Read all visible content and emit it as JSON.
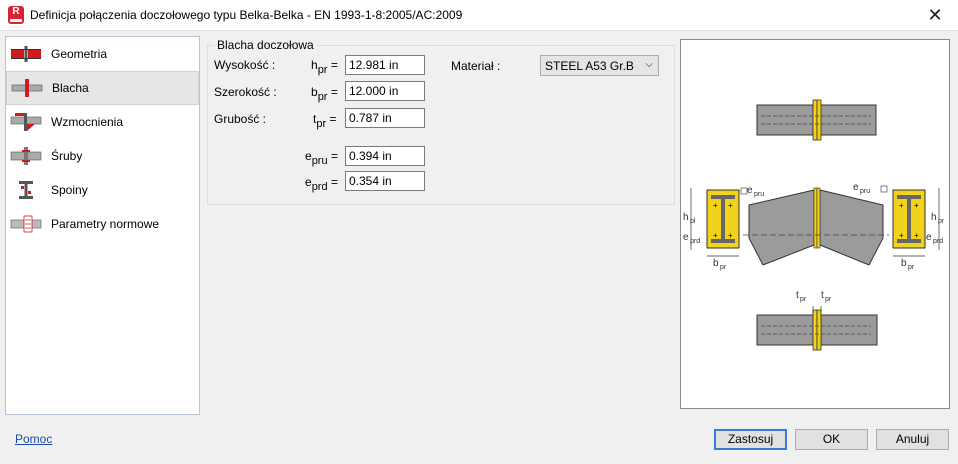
{
  "window": {
    "app_icon_letter": "R",
    "title": "Definicja połączenia doczołowego typu Belka-Belka - EN 1993-1-8:2005/AC:2009",
    "close_glyph": "✕"
  },
  "sidebar": {
    "items": [
      {
        "label": "Geometria",
        "icon": "beam-geometry-icon",
        "selected": false
      },
      {
        "label": "Blacha",
        "icon": "plate-icon",
        "selected": true
      },
      {
        "label": "Wzmocnienia",
        "icon": "stiffeners-icon",
        "selected": false
      },
      {
        "label": "Śruby",
        "icon": "bolts-icon",
        "selected": false
      },
      {
        "label": "Spoiny",
        "icon": "welds-icon",
        "selected": false
      },
      {
        "label": "Parametry normowe",
        "icon": "code-parameters-icon",
        "selected": false
      }
    ]
  },
  "plate": {
    "group_title": "Blacha doczołowa",
    "height": {
      "label": "Wysokość :",
      "sym": "h",
      "sub": "pr",
      "eq": "=",
      "value": "12.981 in"
    },
    "width": {
      "label": "Szerokość :",
      "sym": "b",
      "sub": "pr",
      "eq": "=",
      "value": "12.000 in"
    },
    "thickness": {
      "label": "Grubość :",
      "sym": "t",
      "sub": "pr",
      "eq": "=",
      "value": "0.787 in"
    },
    "e_upper": {
      "sym": "e",
      "sub": "pru",
      "eq": "=",
      "value": "0.394 in"
    },
    "e_lower": {
      "sym": "e",
      "sub": "prd",
      "eq": "=",
      "value": "0.354 in"
    },
    "material": {
      "label": "Materiał :",
      "value": "STEEL A53 Gr.B"
    }
  },
  "diagram": {
    "labels": {
      "e_pru": "epru",
      "h_pl": "hpl",
      "h_pr": "hpr",
      "e_prd": "eprd",
      "b_pr": "bpr",
      "t_pr": "tpr"
    }
  },
  "footer": {
    "help": "Pomoc",
    "apply": "Zastosuj",
    "ok": "OK",
    "cancel": "Anuluj"
  },
  "colors": {
    "accent": "#3d7ad6",
    "link": "#1a4fa8",
    "plate_yellow": "#f2d21b",
    "beam_gray": "#9b9b9b"
  }
}
